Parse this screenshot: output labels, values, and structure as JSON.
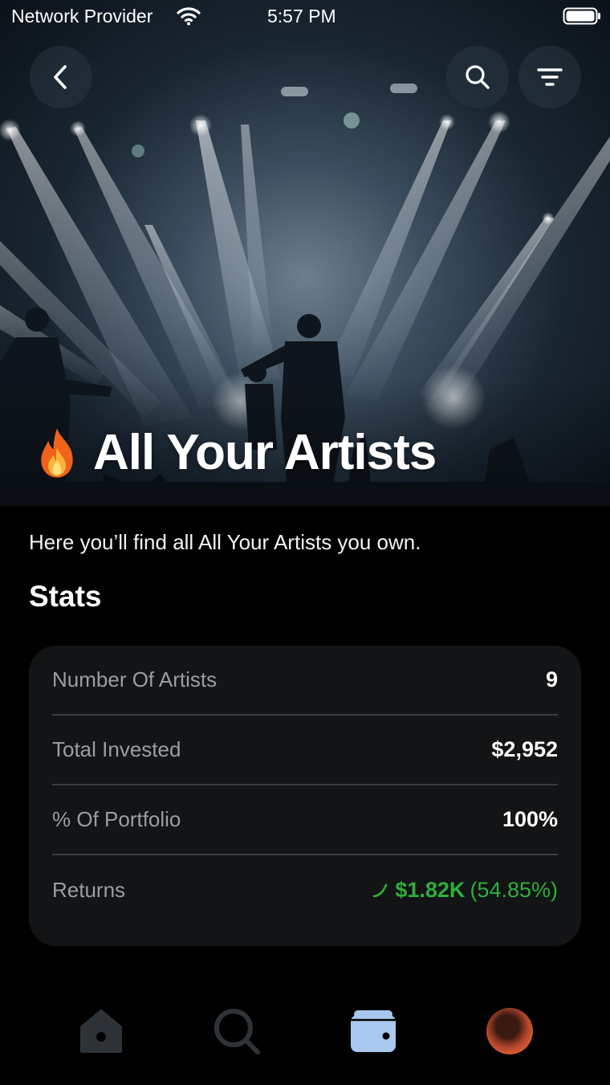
{
  "status_bar": {
    "carrier": "Network Provider",
    "time": "5:57 PM"
  },
  "hero": {
    "title": "All Your Artists",
    "title_icon": "fire-emoji"
  },
  "top_actions": {
    "back_icon": "chevron-left-icon",
    "search_icon": "search-icon",
    "filter_icon": "filter-icon"
  },
  "description": "Here you’ll find all All Your Artists you own.",
  "stats": {
    "heading": "Stats",
    "rows": [
      {
        "label": "Number Of Artists",
        "value": "9"
      },
      {
        "label": "Total Invested",
        "value": "$2,952"
      },
      {
        "label": "% Of Portfolio",
        "value": "100%"
      }
    ],
    "returns": {
      "label": "Returns",
      "amount": "$1.82K",
      "percent": "(54.85%)",
      "trend": "up",
      "color": "#2fae3c"
    }
  },
  "tab_bar": {
    "items": [
      "home",
      "search",
      "wallet",
      "profile"
    ],
    "active": "wallet",
    "active_color": "#a9c8f0",
    "inactive_color": "#2e3338"
  }
}
